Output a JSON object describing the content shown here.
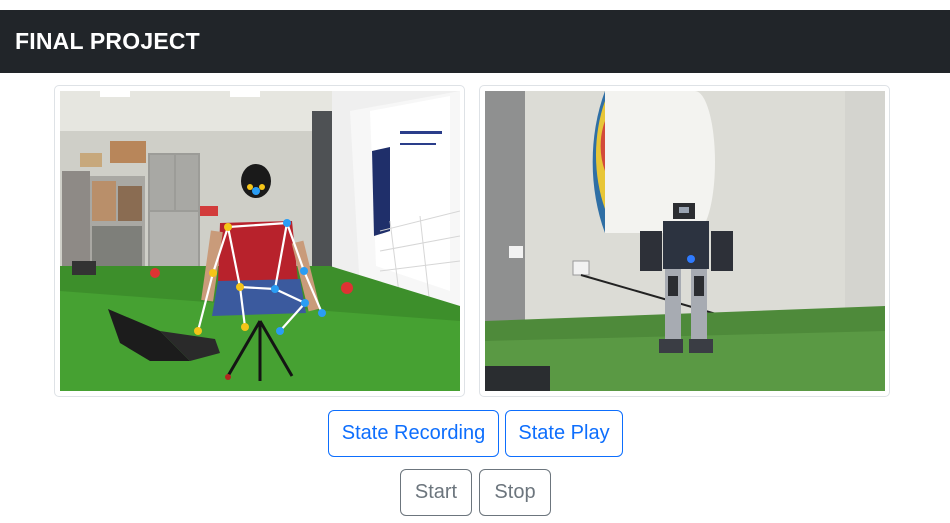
{
  "navbar": {
    "title": "FINAL PROJECT"
  },
  "feeds": {
    "left": {
      "semantic": "camera feed of person seated with pose skeleton overlay"
    },
    "right": {
      "semantic": "camera feed of humanoid robot in front of target board"
    }
  },
  "controls": {
    "state_recording_label": "State Recording",
    "state_play_label": "State Play",
    "start_label": "Start",
    "stop_label": "Stop"
  },
  "colors": {
    "navbar_bg": "#212529",
    "primary": "#0d6efd",
    "secondary": "#6c757d",
    "pose_joint": "#f5c518",
    "pose_joint_blue": "#2a9df4"
  }
}
